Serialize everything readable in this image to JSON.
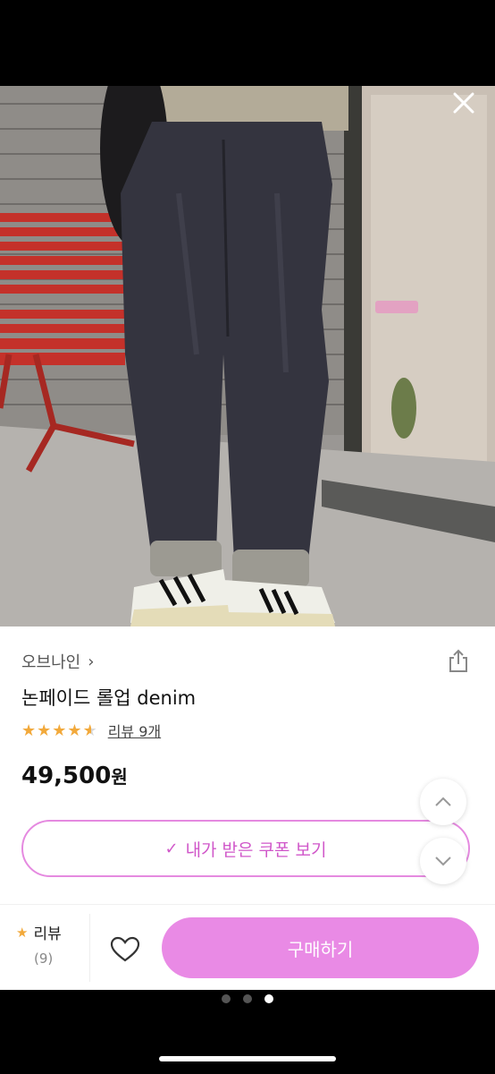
{
  "product": {
    "brand": "오브나인",
    "brand_chevron": "›",
    "title": "논페이드 롤업 denim",
    "rating": 4.5,
    "review_link": "리뷰 9개",
    "price": "49,500",
    "currency": "원"
  },
  "coupon": {
    "label": "내가 받은 쿠폰 보기",
    "check": "✓"
  },
  "bottom_bar": {
    "review_label": "리뷰",
    "review_count": "(9)",
    "buy_label": "구매하기"
  },
  "gallery": {
    "dots": 3,
    "active_dot": 3
  },
  "colors": {
    "accent": "#e98ae5",
    "accent_text": "#d057c9",
    "star": "#f2a93b"
  },
  "icons": {
    "close": "close-icon",
    "share": "share-icon",
    "heart": "heart-icon",
    "star": "star-icon",
    "chevron_up": "chevron-up-icon",
    "chevron_down": "chevron-down-icon"
  }
}
